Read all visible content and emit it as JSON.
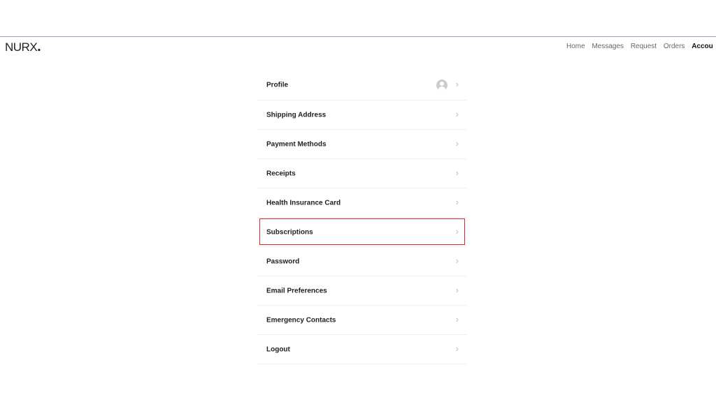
{
  "header": {
    "logo": "NURX",
    "nav": [
      "Home",
      "Messages",
      "Request",
      "Orders",
      "Accou"
    ],
    "active_nav": "Accou"
  },
  "account_menu": {
    "items": [
      {
        "label": "Profile",
        "has_avatar": true
      },
      {
        "label": "Shipping Address"
      },
      {
        "label": "Payment Methods"
      },
      {
        "label": "Receipts"
      },
      {
        "label": "Health Insurance Card"
      },
      {
        "label": "Subscriptions",
        "highlighted": true
      },
      {
        "label": "Password"
      },
      {
        "label": "Email Preferences"
      },
      {
        "label": "Emergency Contacts"
      },
      {
        "label": "Logout"
      }
    ],
    "chevron_icon": "chevron-right-icon"
  },
  "colors": {
    "highlight": "#e0262b",
    "topline": "#a58fcf"
  }
}
